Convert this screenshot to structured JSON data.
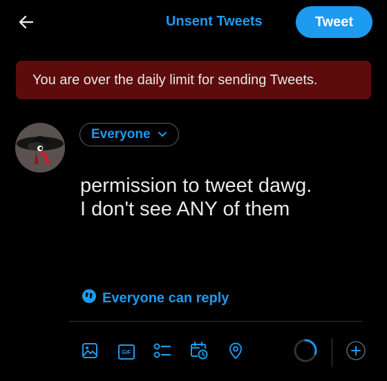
{
  "header": {
    "back_icon": "arrow-left-icon",
    "title": "Unsent Tweets",
    "tweet_button": "Tweet"
  },
  "banner": {
    "message": "You are over the daily limit for sending Tweets."
  },
  "composer": {
    "audience_label": "Everyone",
    "text_line1": "permission to tweet dawg.",
    "text_line2": "I don't see ANY of them",
    "reply_setting": "Everyone can reply"
  },
  "toolbar": {
    "icons": [
      "image-icon",
      "gif-icon",
      "poll-icon",
      "schedule-icon",
      "location-icon",
      "progress-ring-icon",
      "add-icon"
    ],
    "gif_label": "GIF",
    "progress": 0.3
  },
  "colors": {
    "accent": "#1d9bf0",
    "background": "#000000",
    "banner": "#5e0b0b",
    "text": "#e7e9ea"
  }
}
